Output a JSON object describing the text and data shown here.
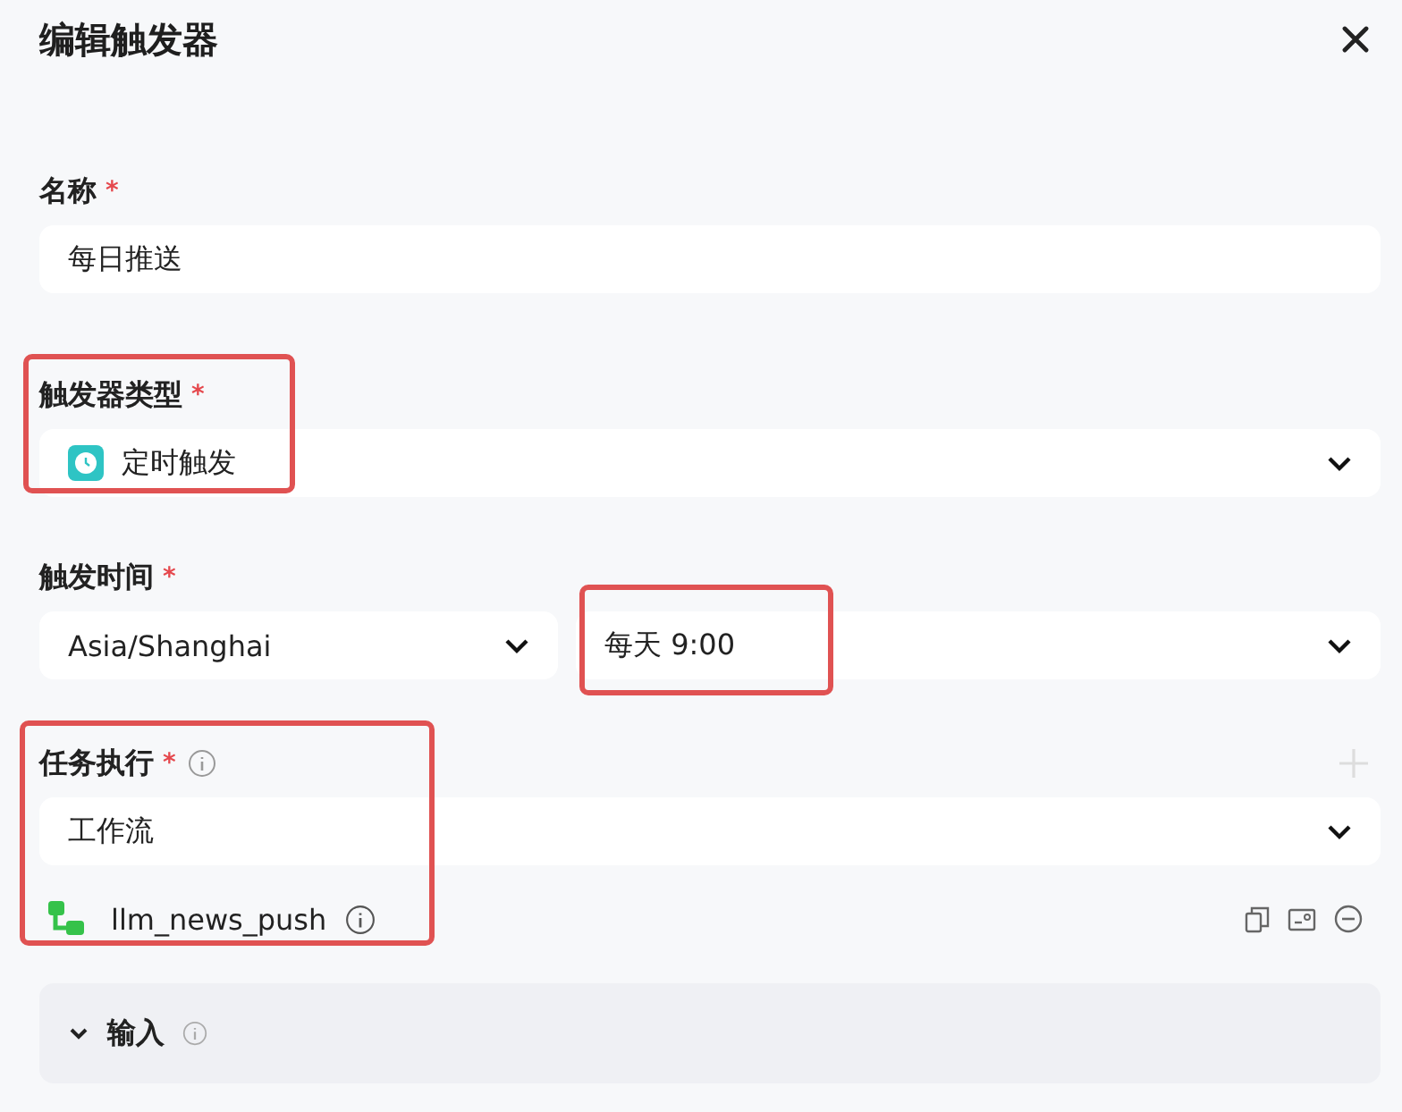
{
  "dialog": {
    "title": "编辑触发器"
  },
  "name_field": {
    "label": "名称",
    "required_mark": "*",
    "value": "每日推送"
  },
  "trigger_type": {
    "label": "触发器类型",
    "required_mark": "*",
    "value": "定时触发",
    "highlighted": true
  },
  "trigger_time": {
    "label": "触发时间",
    "required_mark": "*",
    "timezone": "Asia/Shanghai",
    "schedule": "每天 9:00",
    "schedule_highlighted": true
  },
  "task": {
    "label": "任务执行",
    "required_mark": "*",
    "type": "工作流",
    "workflow": "llm_news_push",
    "highlighted": true
  },
  "input_section": {
    "label": "输入",
    "expanded": true
  }
}
